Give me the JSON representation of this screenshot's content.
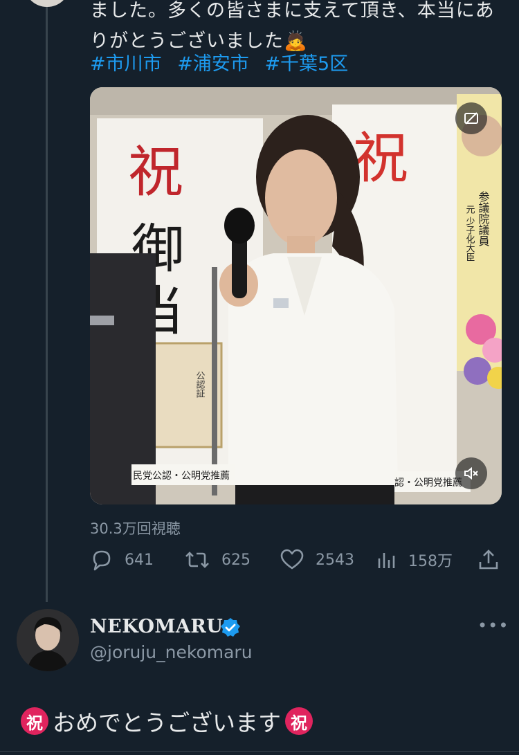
{
  "tweet": {
    "text_line1": "ました。多くの皆さまに支えて頂き、本当にあ",
    "text_line2": "りがとうございました",
    "emoji": "🙇",
    "hashtags": [
      "#市川市",
      "#浦安市",
      "#千葉5区"
    ],
    "media": {
      "banner_char_1": "祝",
      "banner_char_2": "御",
      "banner_char_3": "当",
      "certificate_title": "公認証",
      "footer_left": "民党公認・公明党推薦",
      "footer_right": "認・公明党推薦",
      "poster_text": "元 少子化大臣",
      "poster_role": "参議院議員"
    },
    "views": "30.3万回視聴",
    "stats": {
      "replies": "641",
      "retweets": "625",
      "likes": "2543",
      "analytics": "158万"
    }
  },
  "reply": {
    "display_name": "NEKOMARU",
    "handle": "@joruju_nekomaru",
    "badge_char": "祝",
    "text": "おめでとうございます"
  },
  "icons": [
    "reply-icon",
    "retweet-icon",
    "like-icon",
    "analytics-icon",
    "share-icon",
    "mute-icon",
    "caption-icon",
    "verified-icon",
    "more-icon"
  ],
  "colors": {
    "background": "#15202b",
    "accent": "#1d9bf0",
    "muted": "#8b98a5",
    "badge": "#e0245e"
  }
}
